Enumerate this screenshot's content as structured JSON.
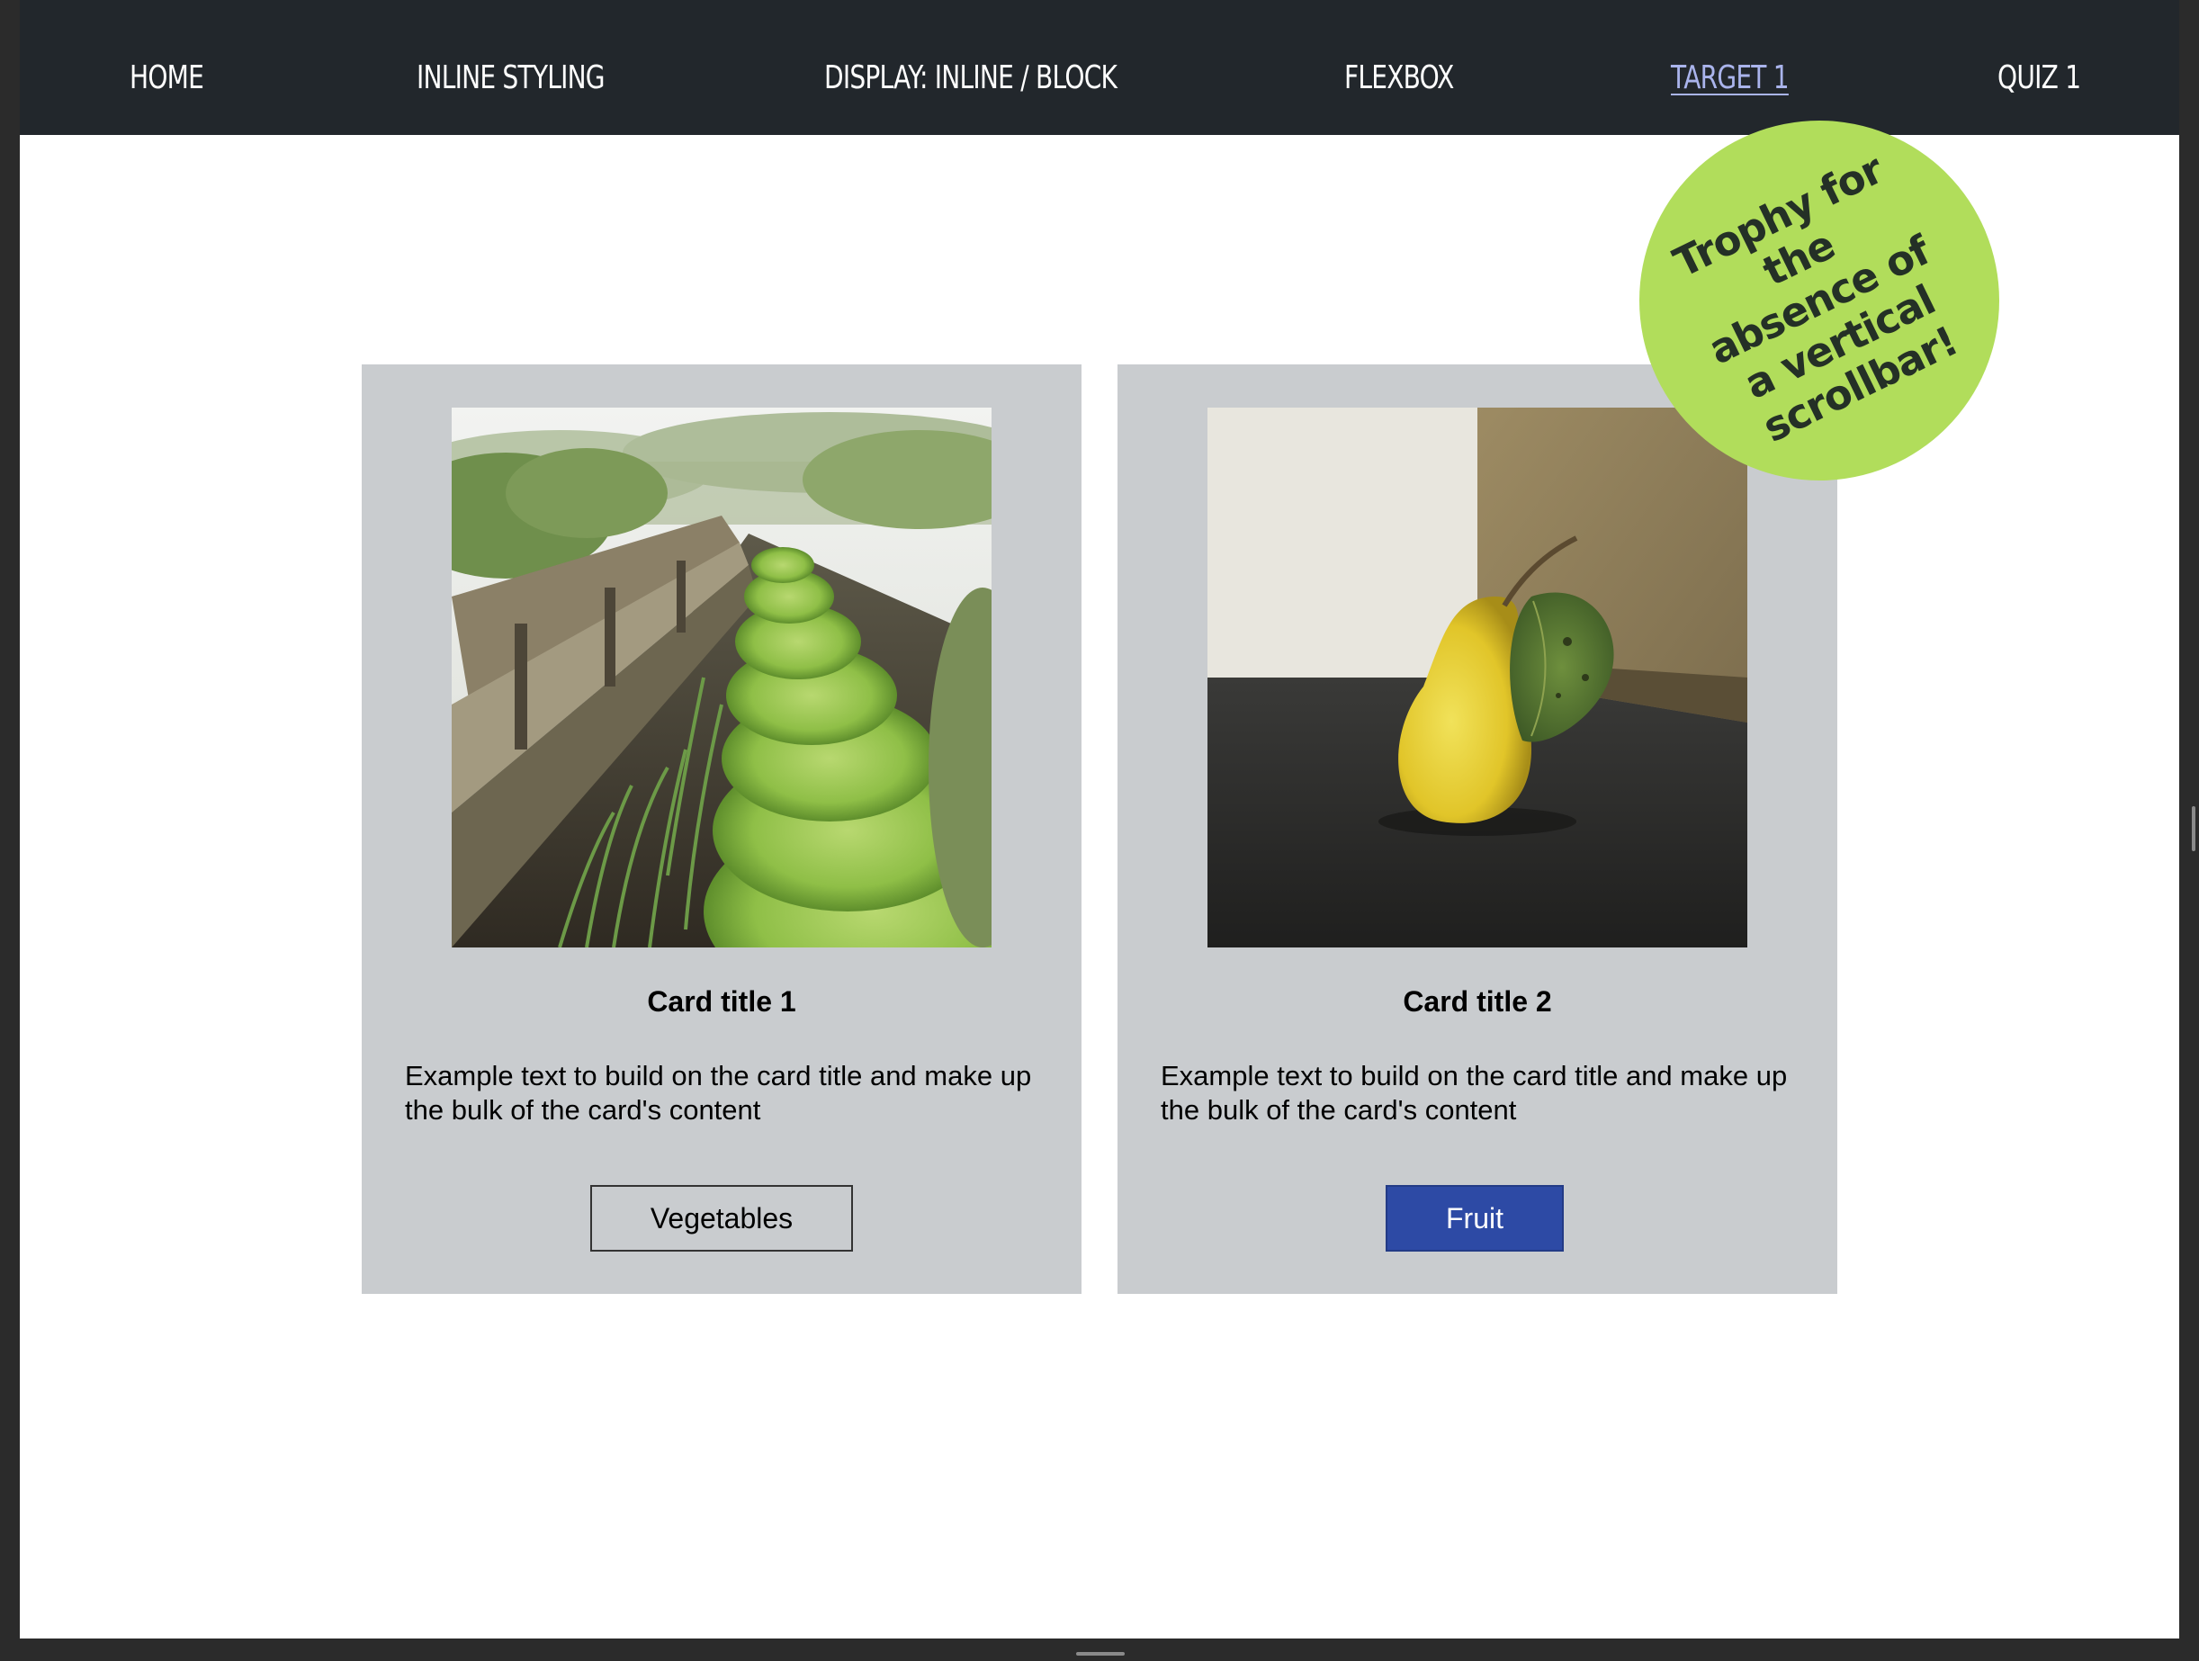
{
  "nav": {
    "items": [
      {
        "label": "HOME"
      },
      {
        "label": "INLINE STYLING"
      },
      {
        "label": "DISPLAY: INLINE / BLOCK"
      },
      {
        "label": "FLEXBOX"
      },
      {
        "label": "TARGET 1",
        "active": true
      },
      {
        "label": "QUIZ 1"
      }
    ]
  },
  "cards": [
    {
      "title": "Card title 1",
      "text": "Example text to build on the card title and make up the bulk of the card's content",
      "button_label": "Vegetables",
      "image": "vegetable-garden-photo"
    },
    {
      "title": "Card title 2",
      "text": "Example text to build on the card title and make up the bulk of the card's content",
      "button_label": "Fruit",
      "image": "pear-photo"
    }
  ],
  "trophy": {
    "text": "Trophy for the absence of a vertical scrollbar!"
  },
  "colors": {
    "navbar_bg": "#22272c",
    "active_link": "#aab4ec",
    "card_bg": "#c9cccf",
    "primary_button": "#2d4aa5",
    "trophy_bg": "#b1dd5b"
  }
}
